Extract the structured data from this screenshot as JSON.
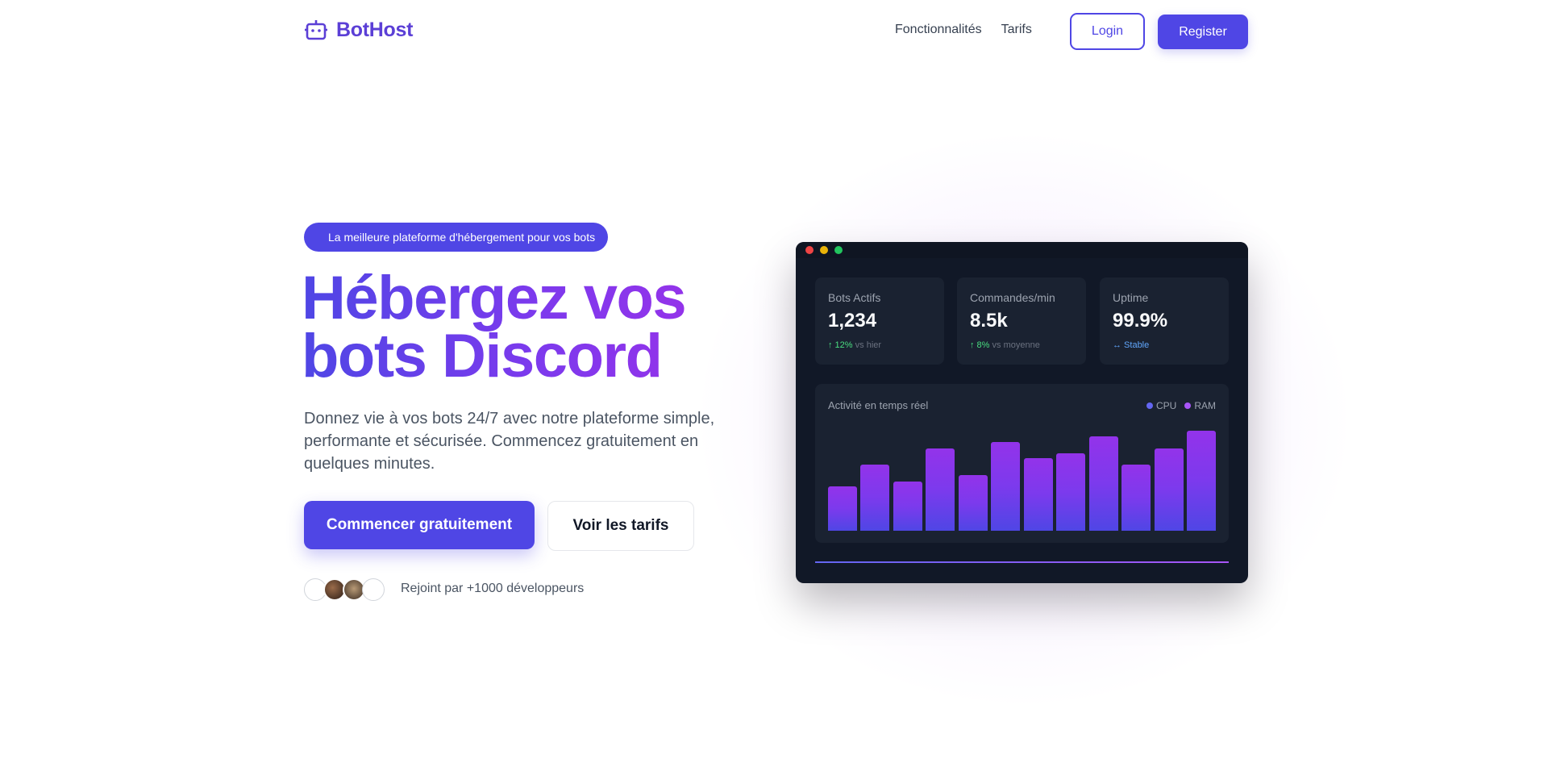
{
  "nav": {
    "brand": "BotHost",
    "links": [
      "Fonctionnalités",
      "Tarifs"
    ],
    "login_label": "Login",
    "register_label": "Register"
  },
  "hero": {
    "badge": "La meilleure plateforme d'hébergement pour vos bots",
    "headline_line1": "Hébergez vos",
    "headline_line2": "bots Discord",
    "subtext": "Donnez vie à vos bots 24/7 avec notre plateforme simple, performante et sécurisée. Commencez gratuitement en quelques minutes.",
    "cta_primary": "Commencer gratuitement",
    "cta_secondary": "Voir les tarifs",
    "joined_text": "Rejoint par +1000 développeurs"
  },
  "dashboard": {
    "stats": [
      {
        "label": "Bots Actifs",
        "value": "1,234",
        "trend_value": "↑ 12%",
        "trend_text": "vs hier"
      },
      {
        "label": "Commandes/min",
        "value": "8.5k",
        "trend_value": "↑ 8%",
        "trend_text": "vs moyenne"
      },
      {
        "label": "Uptime",
        "value": "99.9%",
        "trend_value": "↔ Stable",
        "trend_text": ""
      }
    ],
    "activity_title": "Activité en temps réel",
    "legend": [
      {
        "name": "CPU",
        "color": "#6366f1"
      },
      {
        "name": "RAM",
        "color": "#a855f7"
      }
    ]
  },
  "chart_data": {
    "type": "bar",
    "values": [
      45,
      67,
      50,
      83,
      56,
      90,
      73,
      78,
      95,
      67,
      83,
      101
    ],
    "ylim": [
      0,
      101
    ]
  },
  "colors": {
    "accent": "#4f46e5",
    "accent_purple": "#9333ea",
    "panel": "#111827",
    "card": "#1a2231",
    "trend_up": "#4ade80",
    "stable": "#60a5fa"
  }
}
